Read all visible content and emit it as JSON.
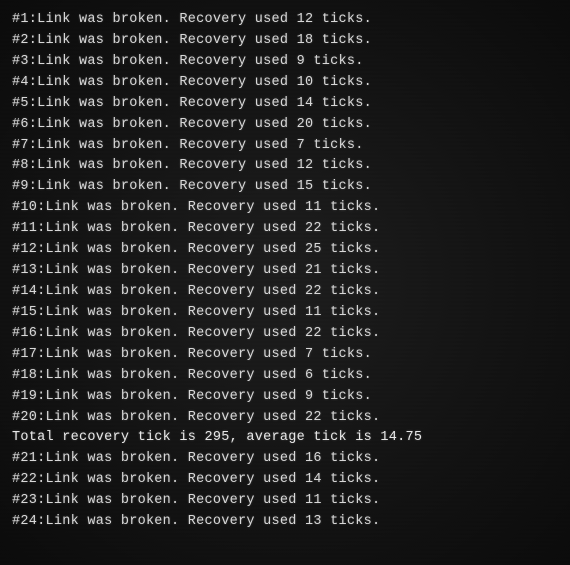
{
  "terminal": {
    "lines": [
      {
        "id": 1,
        "text": "#1:Link was broken. Recovery used 12 ticks.",
        "type": "normal"
      },
      {
        "id": 2,
        "text": "#2:Link was broken. Recovery used 18 ticks.",
        "type": "normal"
      },
      {
        "id": 3,
        "text": "#3:Link was broken. Recovery used 9 ticks.",
        "type": "normal"
      },
      {
        "id": 4,
        "text": "#4:Link was broken. Recovery used 10 ticks.",
        "type": "normal"
      },
      {
        "id": 5,
        "text": "#5:Link was broken. Recovery used 14 ticks.",
        "type": "normal"
      },
      {
        "id": 6,
        "text": "#6:Link was broken. Recovery used 20 ticks.",
        "type": "normal"
      },
      {
        "id": 7,
        "text": "#7:Link was broken. Recovery used 7 ticks.",
        "type": "normal"
      },
      {
        "id": 8,
        "text": "#8:Link was broken. Recovery used 12 ticks.",
        "type": "normal"
      },
      {
        "id": 9,
        "text": "#9:Link was broken. Recovery used 15 ticks.",
        "type": "normal"
      },
      {
        "id": 10,
        "text": "#10:Link was broken. Recovery used 11 ticks.",
        "type": "normal"
      },
      {
        "id": 11,
        "text": "#11:Link was broken. Recovery used 22 ticks.",
        "type": "normal"
      },
      {
        "id": 12,
        "text": "#12:Link was broken. Recovery used 25 ticks.",
        "type": "normal"
      },
      {
        "id": 13,
        "text": "#13:Link was broken. Recovery used 21 ticks.",
        "type": "normal"
      },
      {
        "id": 14,
        "text": "#14:Link was broken. Recovery used 22 ticks.",
        "type": "normal"
      },
      {
        "id": 15,
        "text": "#15:Link was broken. Recovery used 11 ticks.",
        "type": "normal"
      },
      {
        "id": 16,
        "text": "#16:Link was broken. Recovery used 22 ticks.",
        "type": "normal"
      },
      {
        "id": 17,
        "text": "#17:Link was broken. Recovery used 7 ticks.",
        "type": "normal"
      },
      {
        "id": 18,
        "text": "#18:Link was broken. Recovery used 6 ticks.",
        "type": "normal"
      },
      {
        "id": 19,
        "text": "#19:Link was broken. Recovery used 9 ticks.",
        "type": "normal"
      },
      {
        "id": 20,
        "text": "#20:Link was broken. Recovery used 22 ticks.",
        "type": "normal"
      },
      {
        "id": 21,
        "text": "Total recovery tick is 295, average tick is 14.75",
        "type": "summary"
      },
      {
        "id": 22,
        "text": "#21:Link was broken. Recovery used 16 ticks.",
        "type": "normal"
      },
      {
        "id": 23,
        "text": "#22:Link was broken. Recovery used 14 ticks.",
        "type": "normal"
      },
      {
        "id": 24,
        "text": "#23:Link was broken. Recovery used 11 ticks.",
        "type": "normal"
      },
      {
        "id": 25,
        "text": "#24:Link was broken. Recovery used 13 ticks.",
        "type": "normal"
      }
    ]
  }
}
